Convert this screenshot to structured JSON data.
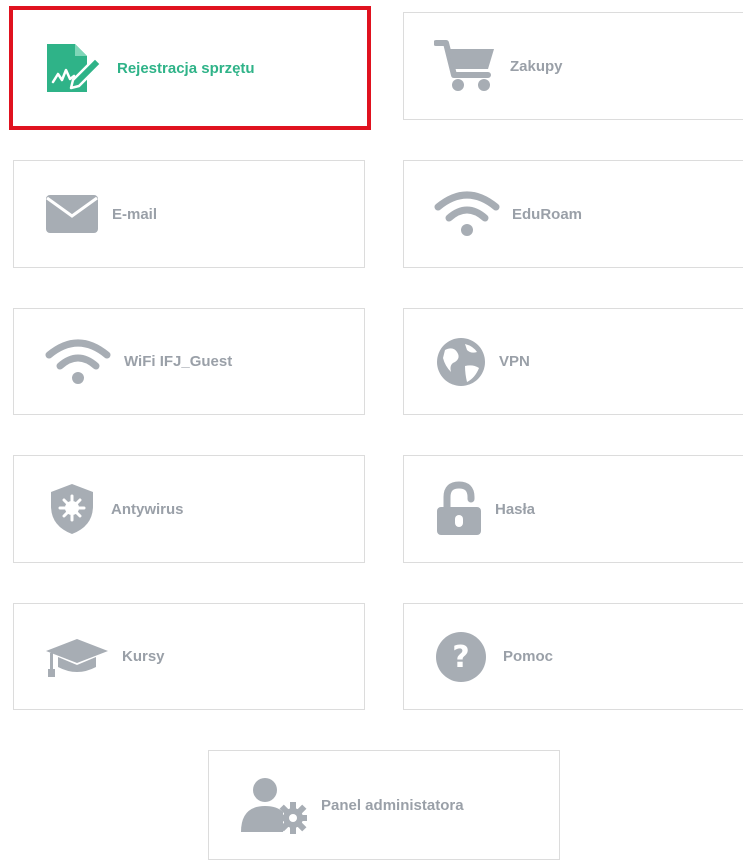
{
  "colors": {
    "accent": "#2fb388",
    "icon_gray": "#a7adb4",
    "label_gray": "#9aa0a8",
    "highlight": "#e0121f"
  },
  "tiles": [
    {
      "label": "Rejestracja sprzętu",
      "icon": "document-signature-icon",
      "active": true,
      "highlighted": true
    },
    {
      "label": "Zakupy",
      "icon": "shopping-cart-icon"
    },
    {
      "label": "E-mail",
      "icon": "envelope-icon"
    },
    {
      "label": "EduRoam",
      "icon": "wifi-icon"
    },
    {
      "label": "WiFi IFJ_Guest",
      "icon": "wifi-icon"
    },
    {
      "label": "VPN",
      "icon": "globe-icon"
    },
    {
      "label": "Antywirus",
      "icon": "shield-virus-icon"
    },
    {
      "label": "Hasła",
      "icon": "unlock-icon"
    },
    {
      "label": "Kursy",
      "icon": "graduation-cap-icon"
    },
    {
      "label": "Pomoc",
      "icon": "question-circle-icon"
    },
    {
      "label": "Panel administatora",
      "icon": "user-cog-icon"
    }
  ]
}
